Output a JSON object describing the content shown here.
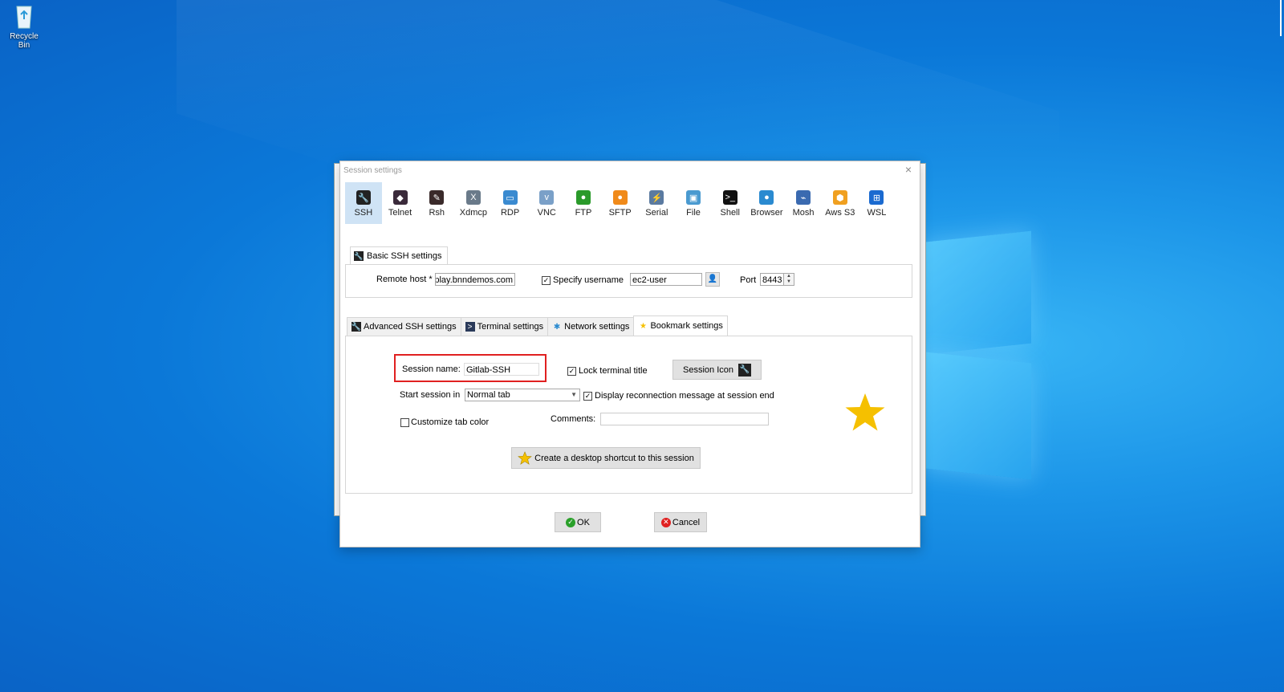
{
  "desktop": {
    "recycle_bin_label": "Recycle Bin"
  },
  "dialog": {
    "title": "Session settings",
    "close_glyph": "×",
    "protocols": [
      {
        "label": "SSH",
        "icon": "ssh-icon",
        "color": "#222"
      },
      {
        "label": "Telnet",
        "icon": "telnet-icon",
        "color": "#3a2a3a"
      },
      {
        "label": "Rsh",
        "icon": "rsh-icon",
        "color": "#3a2a2a"
      },
      {
        "label": "Xdmcp",
        "icon": "xdmcp-icon",
        "color": "#6a7a8a"
      },
      {
        "label": "RDP",
        "icon": "rdp-icon",
        "color": "#3a8ad0"
      },
      {
        "label": "VNC",
        "icon": "vnc-icon",
        "color": "#7aa0c8"
      },
      {
        "label": "FTP",
        "icon": "ftp-icon",
        "color": "#2a9a2a"
      },
      {
        "label": "SFTP",
        "icon": "sftp-icon",
        "color": "#f08a1a"
      },
      {
        "label": "Serial",
        "icon": "serial-icon",
        "color": "#5a7aa0"
      },
      {
        "label": "File",
        "icon": "file-icon",
        "color": "#4a9ad0"
      },
      {
        "label": "Shell",
        "icon": "shell-icon",
        "color": "#111"
      },
      {
        "label": "Browser",
        "icon": "browser-icon",
        "color": "#2a8ad0"
      },
      {
        "label": "Mosh",
        "icon": "mosh-icon",
        "color": "#3a6ab0"
      },
      {
        "label": "Aws S3",
        "icon": "aws-s3-icon",
        "color": "#f0a020"
      },
      {
        "label": "WSL",
        "icon": "wsl-icon",
        "color": "#1a6ad0"
      }
    ],
    "basic": {
      "tab_label": "Basic SSH settings",
      "remote_host_label": "Remote host *",
      "remote_host_value": "play.bnndemos.com",
      "specify_username_label": "Specify username",
      "specify_username_checked": true,
      "username_value": "ec2-user",
      "port_label": "Port",
      "port_value": "8443"
    },
    "tabs": [
      {
        "label": "Advanced SSH settings",
        "icon": "wrench-icon"
      },
      {
        "label": "Terminal settings",
        "icon": "terminal-icon"
      },
      {
        "label": "Network settings",
        "icon": "network-icon"
      },
      {
        "label": "Bookmark settings",
        "icon": "star-icon"
      }
    ],
    "bookmark": {
      "session_name_label": "Session name:",
      "session_name_value": "Gitlab-SSH",
      "lock_title_label": "Lock terminal title",
      "lock_title_checked": true,
      "session_icon_label": "Session Icon",
      "start_session_label": "Start session in",
      "start_session_value": "Normal tab",
      "reconnect_label": "Display reconnection message at session end",
      "reconnect_checked": true,
      "tab_color_label": "Customize tab color",
      "tab_color_checked": false,
      "comments_label": "Comments:",
      "comments_value": "",
      "shortcut_label": "Create a desktop shortcut to this session"
    },
    "ok_label": "OK",
    "cancel_label": "Cancel"
  },
  "colors": {
    "accent_star": "#f5c000",
    "highlight_border": "#e02020",
    "selected_tab": "#cfe3f5"
  }
}
